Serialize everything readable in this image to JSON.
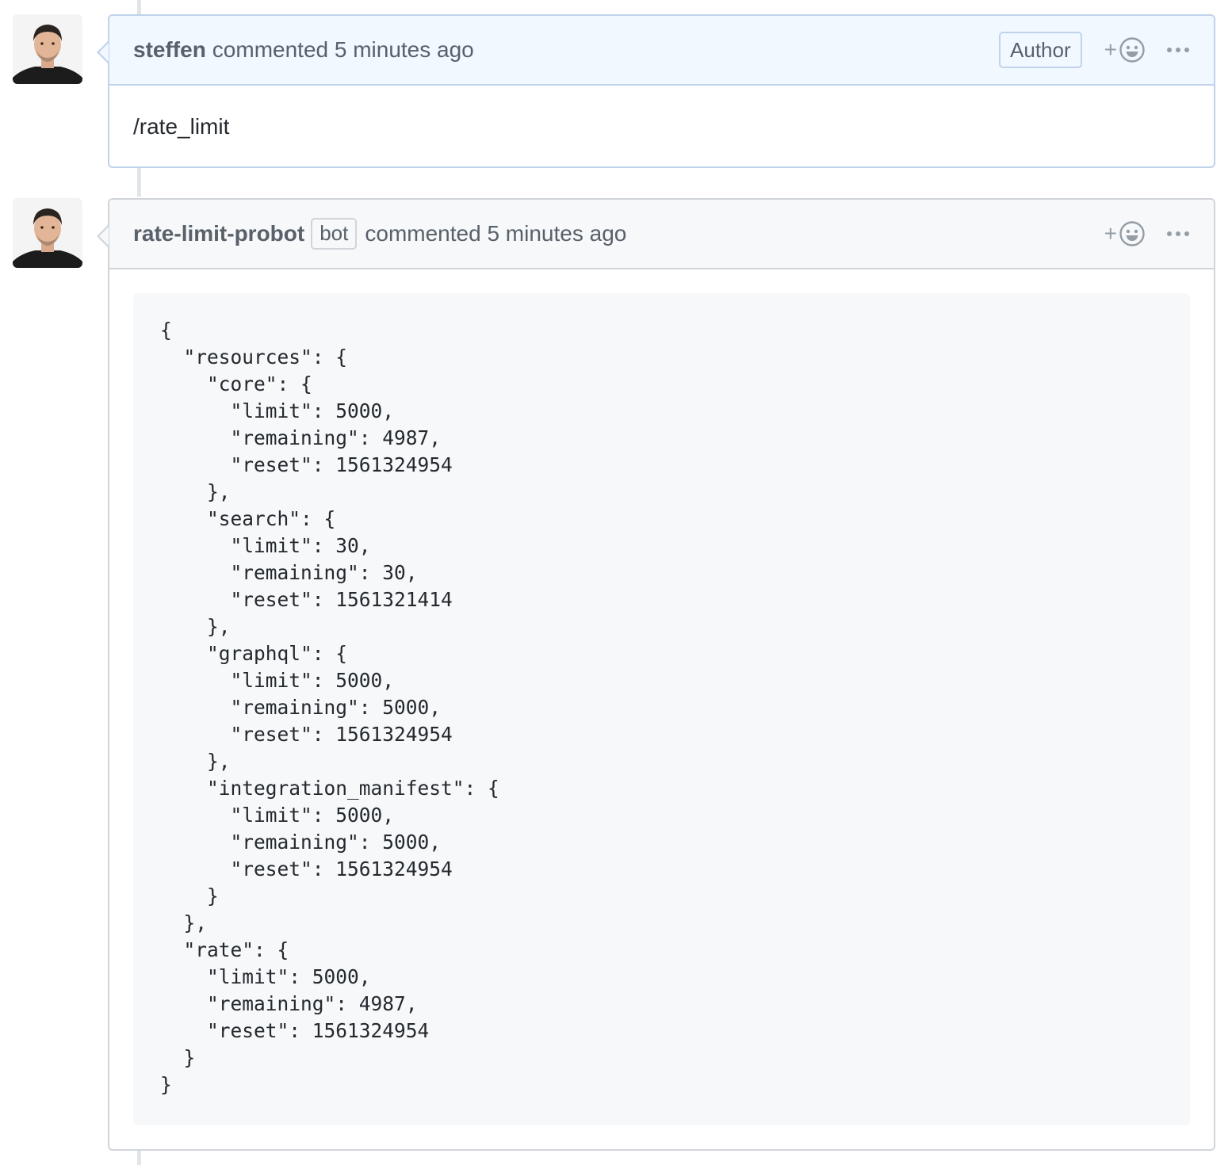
{
  "comments": [
    {
      "username": "steffen",
      "commented_text": "commented 5 minutes ago",
      "author_badge": "Author",
      "plus": "+",
      "body": "/rate_limit"
    },
    {
      "username": "rate-limit-probot",
      "bot_label": "bot",
      "commented_text": "commented 5 minutes ago",
      "plus": "+",
      "code": "{\n  \"resources\": {\n    \"core\": {\n      \"limit\": 5000,\n      \"remaining\": 4987,\n      \"reset\": 1561324954\n    },\n    \"search\": {\n      \"limit\": 30,\n      \"remaining\": 30,\n      \"reset\": 1561321414\n    },\n    \"graphql\": {\n      \"limit\": 5000,\n      \"remaining\": 5000,\n      \"reset\": 1561324954\n    },\n    \"integration_manifest\": {\n      \"limit\": 5000,\n      \"remaining\": 5000,\n      \"reset\": 1561324954\n    }\n  },\n  \"rate\": {\n    \"limit\": 5000,\n    \"remaining\": 4987,\n    \"reset\": 1561324954\n  }\n}"
    }
  ],
  "icons": {
    "reaction": "smiley-icon",
    "more": "kebab-horizontal-icon",
    "avatar": "user-avatar"
  },
  "colors": {
    "author_header_bg": "#f1f8ff",
    "author_border": "#c0d3eb",
    "default_header_bg": "#f6f8fa",
    "default_border": "#d1d5da",
    "code_bg": "#f6f8fa"
  }
}
